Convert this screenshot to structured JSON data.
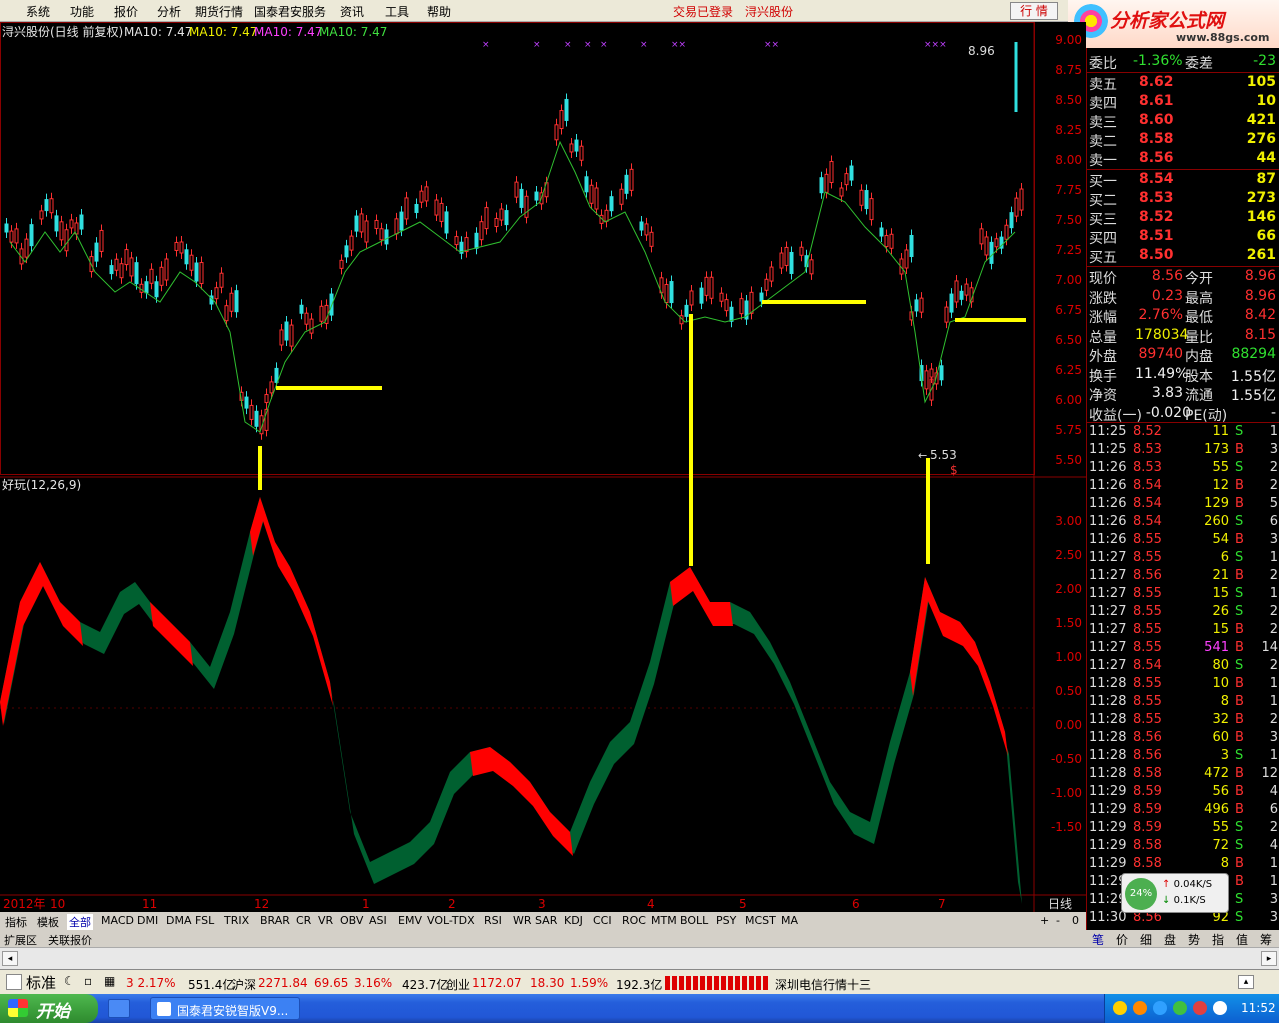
{
  "menu": {
    "items": [
      "系统",
      "功能",
      "报价",
      "分析",
      "期货行情",
      "国泰君安服务",
      "资讯",
      "工具",
      "帮助"
    ],
    "login_status": "交易已登录",
    "stock_link": "浔兴股份",
    "quote_button": "行 情"
  },
  "logo": {
    "title": "分析家公式网",
    "subtitle": "www.88gs.com"
  },
  "chart": {
    "header": "浔兴股份(日线 前复权)",
    "ma_labels": [
      "MA10: 7.47",
      "MA10: 7.47",
      "MA10: 7.47",
      "MA10: 7.47"
    ],
    "price_axis": [
      "9.00",
      "8.75",
      "8.50",
      "8.25",
      "8.00",
      "7.75",
      "7.50",
      "7.25",
      "7.00",
      "6.75",
      "6.50",
      "6.25",
      "6.00",
      "5.75",
      "5.50"
    ],
    "high_label": "8.96",
    "low_label": "5.53",
    "indicator_title": "好玩(12,26,9)",
    "indicator_axis": [
      "3.00",
      "2.50",
      "2.00",
      "1.50",
      "1.00",
      "0.50",
      "0.00",
      "-0.50",
      "-1.00",
      "-1.50"
    ],
    "time_axis": [
      "2012年",
      "10",
      "11",
      "12",
      "1",
      "2",
      "3",
      "4",
      "5",
      "6",
      "7"
    ],
    "period": "日线"
  },
  "quote": {
    "weibi": {
      "label": "委比",
      "value": "-1.36%",
      "label2": "委差",
      "value2": "-23"
    },
    "sell": [
      {
        "label": "卖五",
        "price": "8.62",
        "vol": "105"
      },
      {
        "label": "卖四",
        "price": "8.61",
        "vol": "10"
      },
      {
        "label": "卖三",
        "price": "8.60",
        "vol": "421"
      },
      {
        "label": "卖二",
        "price": "8.58",
        "vol": "276"
      },
      {
        "label": "卖一",
        "price": "8.56",
        "vol": "44"
      }
    ],
    "buy": [
      {
        "label": "买一",
        "price": "8.54",
        "vol": "87"
      },
      {
        "label": "买二",
        "price": "8.53",
        "vol": "273"
      },
      {
        "label": "买三",
        "price": "8.52",
        "vol": "146"
      },
      {
        "label": "买四",
        "price": "8.51",
        "vol": "66"
      },
      {
        "label": "买五",
        "price": "8.50",
        "vol": "261"
      }
    ],
    "stats": [
      {
        "l1": "现价",
        "v1": "8.56",
        "l2": "今开",
        "v2": "8.96"
      },
      {
        "l1": "涨跌",
        "v1": "0.23",
        "l2": "最高",
        "v2": "8.96"
      },
      {
        "l1": "涨幅",
        "v1": "2.76%",
        "l2": "最低",
        "v2": "8.42"
      },
      {
        "l1": "总量",
        "v1": "178034",
        "l2": "量比",
        "v2": "8.15"
      },
      {
        "l1": "外盘",
        "v1": "89740",
        "l2": "内盘",
        "v2": "88294"
      },
      {
        "l1": "换手",
        "v1": "11.49%",
        "l2": "股本",
        "v2": "1.55亿"
      },
      {
        "l1": "净资",
        "v1": "3.83",
        "l2": "流通",
        "v2": "1.55亿"
      },
      {
        "l1": "收益(一)",
        "v1": "-0.020",
        "l2": "PE(动)",
        "v2": "-"
      }
    ]
  },
  "ticks": [
    {
      "t": "11:25",
      "p": "8.52",
      "v": "11",
      "d": "S",
      "n": "1"
    },
    {
      "t": "11:25",
      "p": "8.53",
      "v": "173",
      "d": "B",
      "n": "3"
    },
    {
      "t": "11:26",
      "p": "8.53",
      "v": "55",
      "d": "S",
      "n": "2"
    },
    {
      "t": "11:26",
      "p": "8.54",
      "v": "12",
      "d": "B",
      "n": "2"
    },
    {
      "t": "11:26",
      "p": "8.54",
      "v": "129",
      "d": "B",
      "n": "5"
    },
    {
      "t": "11:26",
      "p": "8.54",
      "v": "260",
      "d": "S",
      "n": "6"
    },
    {
      "t": "11:26",
      "p": "8.55",
      "v": "54",
      "d": "B",
      "n": "3"
    },
    {
      "t": "11:27",
      "p": "8.55",
      "v": "6",
      "d": "S",
      "n": "1"
    },
    {
      "t": "11:27",
      "p": "8.56",
      "v": "21",
      "d": "B",
      "n": "2"
    },
    {
      "t": "11:27",
      "p": "8.55",
      "v": "15",
      "d": "S",
      "n": "1"
    },
    {
      "t": "11:27",
      "p": "8.55",
      "v": "26",
      "d": "S",
      "n": "2"
    },
    {
      "t": "11:27",
      "p": "8.55",
      "v": "15",
      "d": "B",
      "n": "2"
    },
    {
      "t": "11:27",
      "p": "8.55",
      "v": "541",
      "d": "B",
      "n": "14"
    },
    {
      "t": "11:27",
      "p": "8.54",
      "v": "80",
      "d": "S",
      "n": "2"
    },
    {
      "t": "11:28",
      "p": "8.55",
      "v": "10",
      "d": "B",
      "n": "1"
    },
    {
      "t": "11:28",
      "p": "8.55",
      "v": "8",
      "d": "B",
      "n": "1"
    },
    {
      "t": "11:28",
      "p": "8.55",
      "v": "32",
      "d": "B",
      "n": "2"
    },
    {
      "t": "11:28",
      "p": "8.56",
      "v": "60",
      "d": "B",
      "n": "3"
    },
    {
      "t": "11:28",
      "p": "8.56",
      "v": "3",
      "d": "S",
      "n": "1"
    },
    {
      "t": "11:28",
      "p": "8.58",
      "v": "472",
      "d": "B",
      "n": "12"
    },
    {
      "t": "11:29",
      "p": "8.59",
      "v": "56",
      "d": "B",
      "n": "4"
    },
    {
      "t": "11:29",
      "p": "8.59",
      "v": "496",
      "d": "B",
      "n": "6"
    },
    {
      "t": "11:29",
      "p": "8.59",
      "v": "55",
      "d": "S",
      "n": "2"
    },
    {
      "t": "11:29",
      "p": "8.58",
      "v": "72",
      "d": "S",
      "n": "4"
    },
    {
      "t": "11:29",
      "p": "8.58",
      "v": "8",
      "d": "B",
      "n": "1"
    },
    {
      "t": "11:29",
      "p": "8.58",
      "v": "5",
      "d": "B",
      "n": "1"
    },
    {
      "t": "11:29",
      "p": "8.58",
      "v": "8",
      "d": "S",
      "n": "3"
    },
    {
      "t": "11:30",
      "p": "8.56",
      "v": "92",
      "d": "S",
      "n": "3"
    }
  ],
  "net_widget": {
    "percent": "24%",
    "up": "0.04K/S",
    "down": "0.1K/S"
  },
  "tabs": [
    "指标",
    "模板",
    "全部",
    "MACD",
    "DMI",
    "DMA",
    "FSL",
    "TRIX",
    "BRAR",
    "CR",
    "VR",
    "OBV",
    "ASI",
    "EMV",
    "VOL-TDX",
    "RSI",
    "WR",
    "SAR",
    "KDJ",
    "CCI",
    "ROC",
    "MTM",
    "BOLL",
    "PSY",
    "MCST",
    "MA"
  ],
  "tab_controls": [
    "+",
    "-",
    "0"
  ],
  "tabs2": [
    "扩展区",
    "关联报价"
  ],
  "right_tabs": [
    "笔",
    "价",
    "细",
    "盘",
    "势",
    "指",
    "值",
    "筹"
  ],
  "status": {
    "mode": "标准",
    "seg1": "3 2.17%",
    "seg2": "551.4亿",
    "hs_label": "沪深",
    "hs_value": "2271.84",
    "hs_change": "69.65",
    "hs_pct": "3.16%",
    "hs_amount": "423.7亿",
    "cy_label": "创业",
    "cy_value": "1172.07",
    "cy_change": "18.30",
    "cy_pct": "1.59%",
    "cy_amount": "192.3亿",
    "news": "深圳电信行情十三"
  },
  "taskbar": {
    "start": "开始",
    "task": "国泰君安锐智版V9...",
    "clock": "11:52"
  }
}
